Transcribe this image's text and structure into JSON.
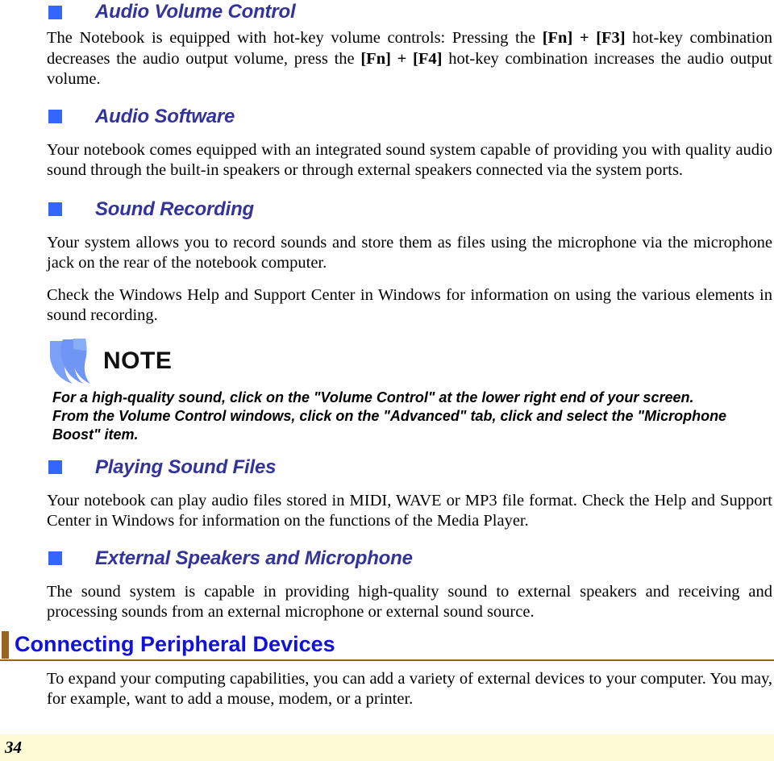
{
  "document": {
    "page_number": "34"
  },
  "sections": [
    {
      "heading": "Audio Volume Control",
      "bullet_icon": "blue-square-bullet",
      "paragraphs": [
        "The Notebook is equipped with hot-key volume controls: Pressing the [Fn] + [F3] hot-key combination decreases the audio output volume, press the [Fn] + [F4] hot-key combination increases the audio output volume."
      ],
      "paragraph_runs": [
        [
          {
            "text": "The Notebook is equipped with hot-key volume controls: Pressing the ",
            "bold": false
          },
          {
            "text": "[Fn] + [F3]",
            "bold": true
          },
          {
            "text": " hot-key combination decreases the audio output volume, press the ",
            "bold": false
          },
          {
            "text": "[Fn] + [F4]",
            "bold": true
          },
          {
            "text": " hot-key combination increases the audio output volume.",
            "bold": false
          }
        ]
      ]
    },
    {
      "heading": "Audio Software",
      "bullet_icon": "blue-square-bullet",
      "paragraphs": [
        "Your notebook comes equipped with an integrated sound system capable of providing you with quality audio sound through the built-in speakers or through external speakers connected via the system ports."
      ]
    },
    {
      "heading": "Sound Recording",
      "bullet_icon": "blue-square-bullet",
      "paragraphs": [
        "Your system allows you to record sounds and store them as files using the microphone via the microphone jack on the rear of the notebook computer.",
        "Check the Windows Help and Support Center in Windows for information on using the various elements in sound recording."
      ]
    },
    {
      "heading": "Playing Sound Files",
      "bullet_icon": "blue-square-bullet",
      "paragraphs": [
        "Your notebook can play audio files stored in MIDI, WAVE or MP3 file format.  Check the Help and Support Center in Windows for information on the functions of the Media Player."
      ]
    },
    {
      "heading": "External Speakers and Microphone",
      "bullet_icon": "blue-square-bullet",
      "paragraphs": [
        "The sound system is capable in providing high-quality sound to external speakers and receiving and processing sounds from an external microphone or external sound source."
      ]
    }
  ],
  "note_callout": {
    "logo_icon": "note-feather-logo",
    "label": "NOTE",
    "text": "For a high-quality sound, click on the \"Volume Control\" at the lower right end of your screen.   From the Volume Control windows, click on the \"Advanced\" tab, click and select the \"Microphone Boost\" item."
  },
  "chapter_heading": {
    "title": "Connecting Peripheral Devices",
    "accent_bar_color": "#97651f",
    "text_color": "#1111dd"
  },
  "chapter_intro": {
    "paragraph": "To expand your computing capabilities, you can add a variety of external devices to your computer.  You may, for example, want to add a mouse, modem, or a printer."
  },
  "colors": {
    "bullet_blue": "#3366ff",
    "subheading_indigo": "#333399",
    "chapter_blue": "#1111dd",
    "accent_brown": "#97651f",
    "footer_cream": "#fcfbd6",
    "note_logo_blue": "#6f96f5"
  }
}
